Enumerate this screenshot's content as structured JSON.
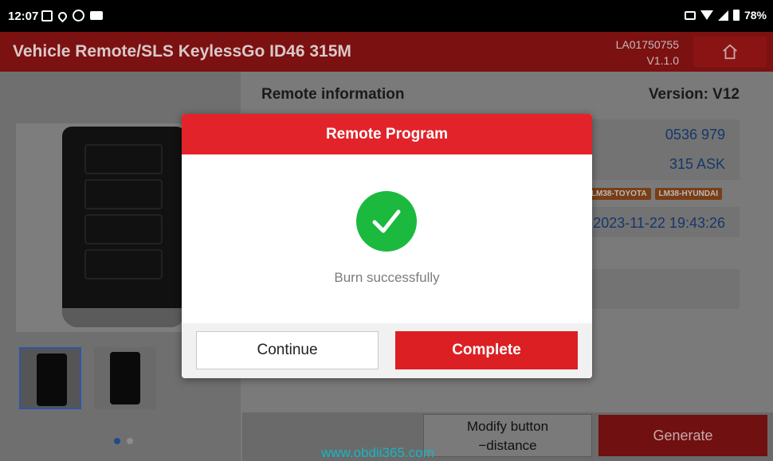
{
  "status_bar": {
    "time": "12:07",
    "battery": "78%"
  },
  "header": {
    "title": "Vehicle Remote/SLS KeylessGo ID46 315M",
    "serial": "LA01750755",
    "app_version": "V1.1.0"
  },
  "remote_info": {
    "title": "Remote information",
    "version": "Version: V12",
    "values": [
      "0536 979",
      "315 ASK",
      "2023-11-22 19:43:26"
    ],
    "tags": [
      "LM38-TOYOTA",
      "LM38-HYUNDAI"
    ]
  },
  "bottom": {
    "modify_line1": "Modify button",
    "modify_line2": "−distance",
    "generate": "Generate"
  },
  "watermark": "www.obdii365.com",
  "dialog": {
    "title": "Remote Program",
    "message": "Burn successfully",
    "continue_label": "Continue",
    "complete_label": "Complete"
  },
  "colors": {
    "header_red": "#e3232a",
    "success_green": "#1cb93f",
    "complete_red": "#dc1f22",
    "value_blue": "#1f57b2"
  },
  "icons": {
    "home": "home-icon",
    "success": "check-circle-icon"
  }
}
